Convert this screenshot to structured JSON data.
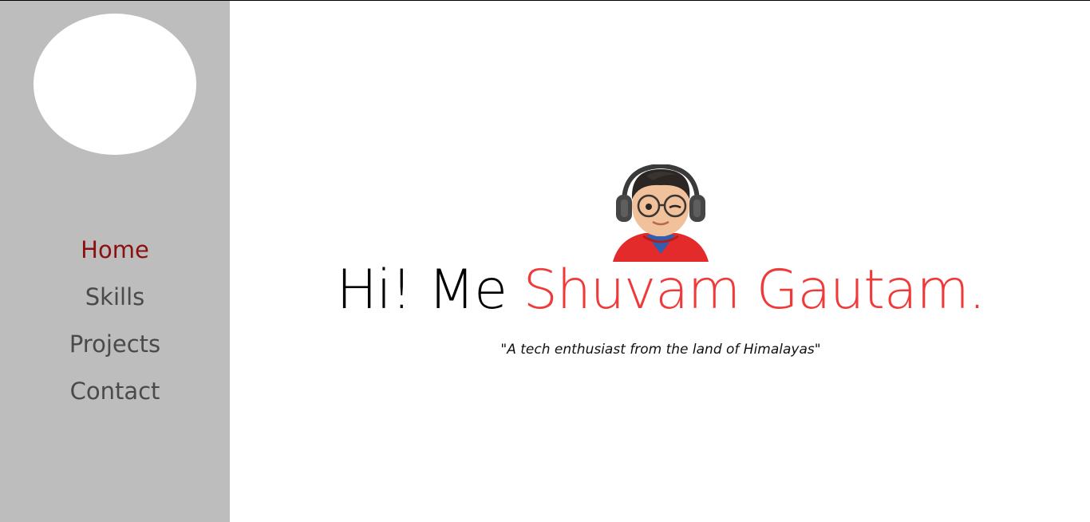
{
  "nav": {
    "items": [
      {
        "label": "Home",
        "active": true
      },
      {
        "label": "Skills",
        "active": false
      },
      {
        "label": "Projects",
        "active": false
      },
      {
        "label": "Contact",
        "active": false
      }
    ]
  },
  "hero": {
    "greeting": "Hi! Me ",
    "name": "Shuvam Gautam.",
    "tagline": "\"A tech enthusiast from the land of Himalayas\""
  },
  "colors": {
    "sidebar_bg": "#bdbdbd",
    "nav_active": "#8b1010",
    "nav_inactive": "#4a4a4a",
    "name_accent": "#f03a3a"
  }
}
